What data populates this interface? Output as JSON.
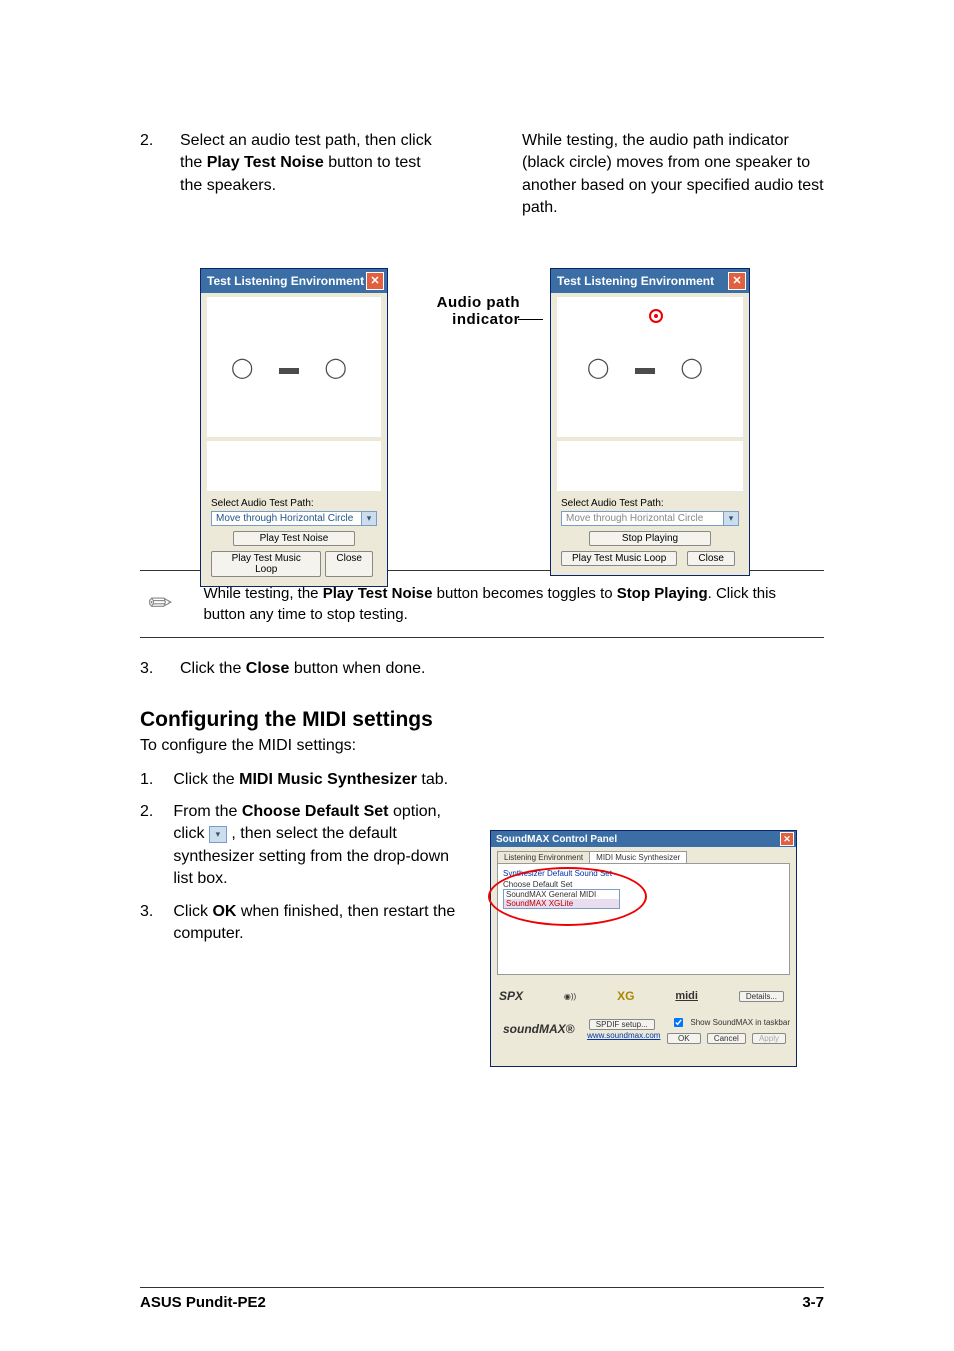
{
  "step2": {
    "num": "2.",
    "left_text_a": "Select an audio test path, then click the ",
    "left_bold": "Play Test Noise",
    "left_text_b": " button to test the speakers.",
    "right_text": "While testing, the audio path indicator (black circle) moves from one speaker to another based on your specified audio test path."
  },
  "callout": {
    "audio_path": "Audio path",
    "indicator": "indicator"
  },
  "win_left": {
    "title": "Test Listening Environment",
    "select_label": "Select Audio Test Path:",
    "drop_value": "Move through Horizontal Circle",
    "btn_play_noise": "Play Test Noise",
    "btn_play_music": "Play Test Music Loop",
    "btn_close": "Close"
  },
  "win_right": {
    "title": "Test Listening Environment",
    "select_label": "Select Audio Test Path:",
    "drop_value": "Move through Horizontal Circle",
    "btn_stop": "Stop Playing",
    "btn_play_music": "Play Test Music Loop",
    "btn_close": "Close"
  },
  "note": {
    "a": "While testing, the ",
    "bold1": "Play Test Noise",
    "b": " button becomes toggles to ",
    "bold2": "Stop Playing",
    "c": ". Click this button any time to stop testing."
  },
  "step3": {
    "num": "3.",
    "a": "Click the ",
    "bold": "Close",
    "b": " button when done."
  },
  "section_title": "Configuring the MIDI settings",
  "section_intro": "To configure the MIDI settings:",
  "midi_steps": {
    "s1": {
      "num": "1.",
      "a": "Click the ",
      "bold1": "MIDI Music Synthesizer",
      "b": " tab."
    },
    "s2": {
      "num": "2.",
      "a": "From the ",
      "bold": "Choose Default Set",
      "b": " option, click ",
      "c": " , then select the default synthesizer setting from the drop-down list box."
    },
    "s3": {
      "num": "3.",
      "a": "Click ",
      "bold": "OK",
      "b": " when finished, then restart the computer."
    }
  },
  "smx": {
    "title": "SoundMAX Control Panel",
    "tab1": "Listening Environment",
    "tab2": "MIDI Music Synthesizer",
    "grp": "Synthesizer Default Sound Set",
    "cds": "Choose Default Set",
    "item1": "SoundMAX General MIDI",
    "item2": "SoundMAX XGLite",
    "spx": "SPX",
    "xg": "XG",
    "midi": "midi",
    "btn_details": "Details...",
    "btn_spdif": "SPDIF setup...",
    "link": "www.soundmax.com",
    "chk": "Show SoundMAX in taskbar",
    "brand": "soundMAX®",
    "ok": "OK",
    "cancel": "Cancel",
    "apply": "Apply"
  },
  "footer": {
    "left": "ASUS Pundit-PE2",
    "right": "3-7"
  }
}
